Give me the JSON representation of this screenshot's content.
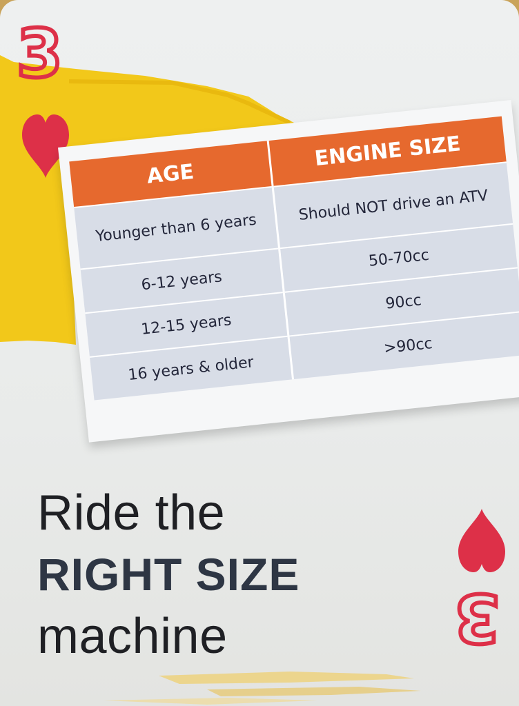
{
  "card": {
    "rank": "3",
    "suit_icon": "heart-icon",
    "suit_color": "#dd3048",
    "accent_yellow": "#f2c81a",
    "header_orange": "#e6692e"
  },
  "table": {
    "headers": [
      "AGE",
      "ENGINE SIZE"
    ],
    "rows": [
      {
        "age": "Younger than 6 years",
        "engine": "Should NOT drive an ATV"
      },
      {
        "age": "6-12 years",
        "engine": "50-70cc"
      },
      {
        "age": "12-15 years",
        "engine": "90cc"
      },
      {
        "age": "16 years & older",
        "engine": ">90cc"
      }
    ]
  },
  "slogan": {
    "line1": "Ride the",
    "line2": "RIGHT SIZE",
    "line3": "machine"
  }
}
